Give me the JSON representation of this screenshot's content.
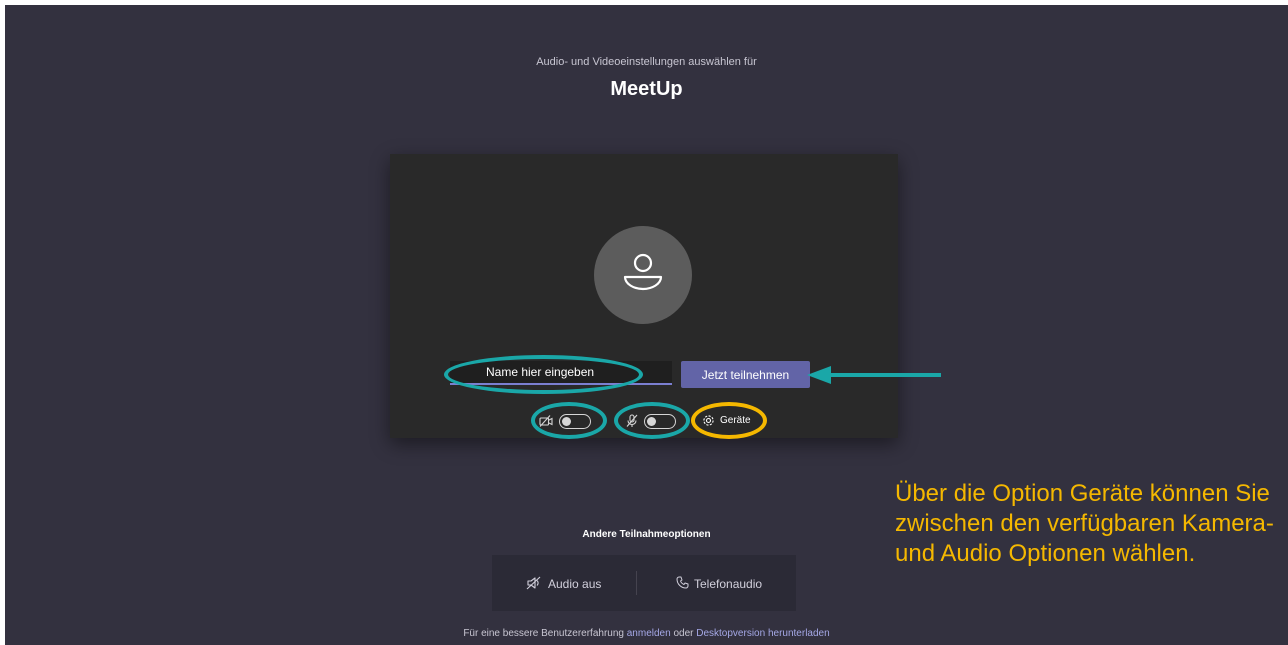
{
  "header": {
    "subtitle": "Audio- und Videoeinstellungen auswählen für",
    "meeting_name": "MeetUp"
  },
  "prejoin": {
    "name_input": {
      "placeholder": "Name hier eingeben",
      "value": ""
    },
    "join_button_label": "Jetzt teilnehmen",
    "camera_toggle": {
      "on": false,
      "icon": "camera-off-icon"
    },
    "mic_toggle": {
      "on": false,
      "icon": "mic-off-icon"
    },
    "devices_label": "Geräte",
    "devices_icon": "gear-icon"
  },
  "other_options": {
    "heading": "Andere Teilnahmeoptionen",
    "audio_off_label": "Audio aus",
    "audio_off_icon": "speaker-off-icon",
    "phone_audio_label": "Telefonaudio",
    "phone_audio_icon": "phone-icon"
  },
  "footer": {
    "prefix": "Für eine bessere Benutzererfahrung",
    "signin_link": "anmelden",
    "or": "oder",
    "download_link": "Desktopversion herunterladen"
  },
  "annotation": {
    "text": "Über die Option Geräte können Sie zwischen den verfügbaren Kamera- und Audio Optionen wählen.",
    "teal_color": "#1aa7a8",
    "yellow_color": "#f5b800"
  },
  "colors": {
    "background": "#33313f",
    "panel": "#292929",
    "accent": "#6264a7"
  }
}
